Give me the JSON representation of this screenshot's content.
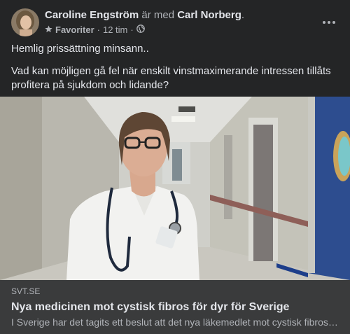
{
  "post": {
    "author": "Caroline Engström",
    "with_text": "är med",
    "tagged": "Carl Norberg",
    "tagged_suffix": ".",
    "audience_label": "Favoriter",
    "separator1": "·",
    "time": "12 tim",
    "separator2": "·",
    "audience_icon": "globe-icon",
    "more_icon": "more-horizontal-icon",
    "paragraphs": [
      "Hemlig prissättning minsann..",
      "Vad kan möjligen gå fel när enskilt vinstmaximerande intressen tillåts profitera på sjukdom och lidande?"
    ]
  },
  "link_preview": {
    "domain": "SVT.SE",
    "title": "Nya medicinen mot cystisk fibros för dyr för Sverige",
    "description": "I Sverige har det tagits ett beslut att det nya läkemedlet mot cystisk fibros är för dyrt"
  },
  "colors": {
    "background": "#242526",
    "link_box": "#3a3b3c",
    "primary_text": "#e4e6eb",
    "secondary_text": "#b0b3b8"
  }
}
